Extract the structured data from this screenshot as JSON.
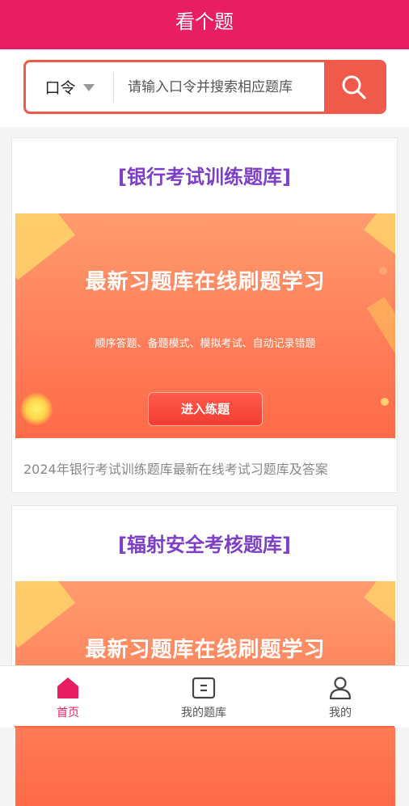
{
  "header": {
    "title": "看个题"
  },
  "search": {
    "selector_label": "口令",
    "placeholder": "请输入口令并搜索相应题库"
  },
  "cards": [
    {
      "title": "[银行考试训练题库]",
      "banner_headline": "最新习题库在线刷题学习",
      "banner_sub": "顺序答题、备题模式、模拟考试、自动记录错题",
      "banner_button": "进入练题",
      "description": "2024年银行考试训练题库最新在线考试习题库及答案"
    },
    {
      "title": "[辐射安全考核题库]",
      "banner_headline": "最新习题库在线刷题学习"
    }
  ],
  "tabs": [
    {
      "label": "首页",
      "icon": "home-icon",
      "active": true
    },
    {
      "label": "我的题库",
      "icon": "question-bank-icon",
      "active": false
    },
    {
      "label": "我的",
      "icon": "user-icon",
      "active": false
    }
  ],
  "colors": {
    "brand": "#e81e63",
    "accent": "#f05a4b",
    "title_purple": "#7d3fc7"
  }
}
